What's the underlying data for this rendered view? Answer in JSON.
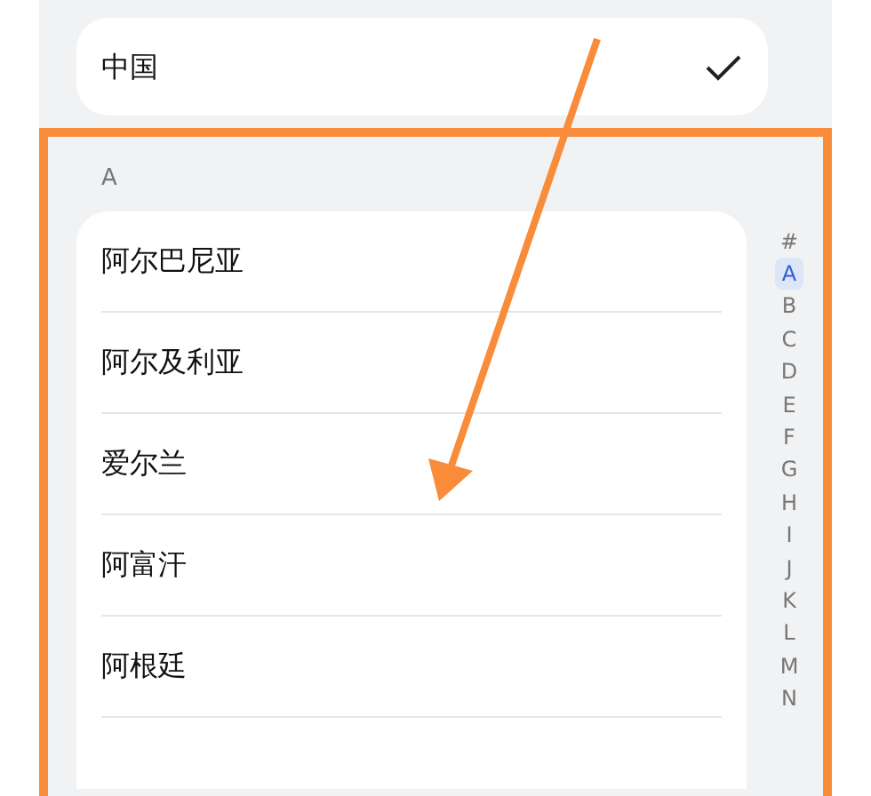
{
  "current_region": {
    "name": "中国",
    "checked": true
  },
  "section_header": "A",
  "countries": [
    {
      "name": "阿尔巴尼亚"
    },
    {
      "name": "阿尔及利亚"
    },
    {
      "name": "爱尔兰"
    },
    {
      "name": "阿富汗"
    },
    {
      "name": "阿根廷"
    }
  ],
  "index": [
    {
      "letter": "#",
      "selected": false
    },
    {
      "letter": "A",
      "selected": true
    },
    {
      "letter": "B",
      "selected": false
    },
    {
      "letter": "C",
      "selected": false
    },
    {
      "letter": "D",
      "selected": false
    },
    {
      "letter": "E",
      "selected": false
    },
    {
      "letter": "F",
      "selected": false
    },
    {
      "letter": "G",
      "selected": false
    },
    {
      "letter": "H",
      "selected": false
    },
    {
      "letter": "I",
      "selected": false
    },
    {
      "letter": "J",
      "selected": false
    },
    {
      "letter": "K",
      "selected": false
    },
    {
      "letter": "L",
      "selected": false
    },
    {
      "letter": "M",
      "selected": false
    },
    {
      "letter": "N",
      "selected": false
    }
  ]
}
